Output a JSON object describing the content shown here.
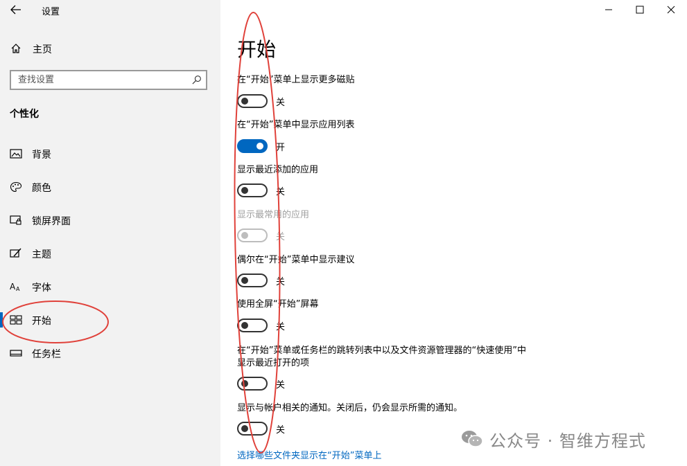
{
  "window": {
    "title": "设置",
    "minimize_icon": "minimize-icon",
    "maximize_icon": "maximize-icon",
    "close_icon": "close-icon"
  },
  "sidebar": {
    "back_icon": "back-arrow-icon",
    "home": {
      "label": "主页",
      "icon": "home-icon"
    },
    "search": {
      "placeholder": "查找设置",
      "icon": "search-icon"
    },
    "section_title": "个性化",
    "items": [
      {
        "label": "背景",
        "icon": "picture-icon",
        "selected": false
      },
      {
        "label": "颜色",
        "icon": "palette-icon",
        "selected": false
      },
      {
        "label": "锁屏界面",
        "icon": "lockscreen-icon",
        "selected": false
      },
      {
        "label": "主题",
        "icon": "brush-icon",
        "selected": false
      },
      {
        "label": "字体",
        "icon": "font-icon",
        "selected": true,
        "_": false
      },
      {
        "label": "开始",
        "icon": "start-tiles-icon",
        "selected": true
      },
      {
        "label": "任务栏",
        "icon": "taskbar-icon",
        "selected": false
      }
    ]
  },
  "main": {
    "title": "开始",
    "settings": [
      {
        "label": "在“开始”菜单上显示更多磁贴",
        "state": "关",
        "on": false,
        "disabled": false
      },
      {
        "label": "在“开始”菜单中显示应用列表",
        "state": "开",
        "on": true,
        "disabled": false
      },
      {
        "label": "显示最近添加的应用",
        "state": "关",
        "on": false,
        "disabled": false
      },
      {
        "label": "显示最常用的应用",
        "state": "关",
        "on": false,
        "disabled": true
      },
      {
        "label": "偶尔在“开始”菜单中显示建议",
        "state": "关",
        "on": false,
        "disabled": false
      },
      {
        "label": "使用全屏“开始”屏幕",
        "state": "关",
        "on": false,
        "disabled": false
      },
      {
        "label_line1": "在“开始”菜单或任务栏的跳转列表中以及文件资源管理器的“快速使用”中",
        "label_line2": "显示最近打开的项",
        "state": "关",
        "on": false,
        "disabled": false
      },
      {
        "label": "显示与帐户相关的通知。关闭后，仍会显示所需的通知。",
        "state": "关",
        "on": false,
        "disabled": false
      }
    ],
    "link": "选择哪些文件夹显示在“开始”菜单上"
  },
  "colors": {
    "accent": "#0067c0",
    "sidebar_bg": "#f2f2f2",
    "annotation": "#e0413a"
  },
  "watermark": {
    "text": "公众号 · 智维方程式",
    "icon": "wechat-icon"
  }
}
